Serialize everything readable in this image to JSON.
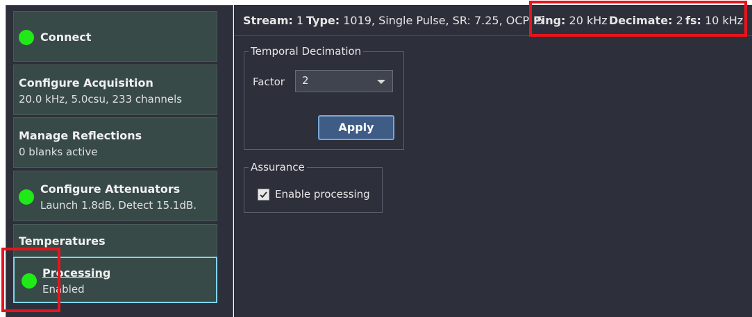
{
  "sidebar": {
    "items": [
      {
        "title": "Connect",
        "sub": ""
      },
      {
        "title": "Configure Acquisition",
        "sub": "20.0 kHz, 5.0csu, 233 channels"
      },
      {
        "title": "Manage Reflections",
        "sub": "0 blanks active"
      },
      {
        "title": "Configure Attenuators",
        "sub": "Launch 1.8dB, Detect 15.1dB."
      },
      {
        "title": "Temperatures",
        "sub": ""
      },
      {
        "title": "Processing",
        "sub": "Enabled"
      }
    ],
    "status_color": "#1fea17"
  },
  "status": {
    "stream_label": "Stream:",
    "stream_value": "1",
    "type_label": "Type:",
    "type_value": "1019, Single Pulse, SR: 7.25, OCP: 5",
    "ping_label": "Ping:",
    "ping_value": "20 kHz",
    "decimate_label": "Decimate:",
    "decimate_value": "2",
    "fs_label": "fs:",
    "fs_value": "10 kHz"
  },
  "temporal": {
    "legend": "Temporal Decimation",
    "factor_label": "Factor",
    "factor_value": "2",
    "apply_label": "Apply"
  },
  "assurance": {
    "legend": "Assurance",
    "enable_label": "Enable processing",
    "enabled": true
  },
  "colors": {
    "highlight": "#e8141c",
    "accent": "#7fd6ee",
    "button": "#3f5c86"
  }
}
